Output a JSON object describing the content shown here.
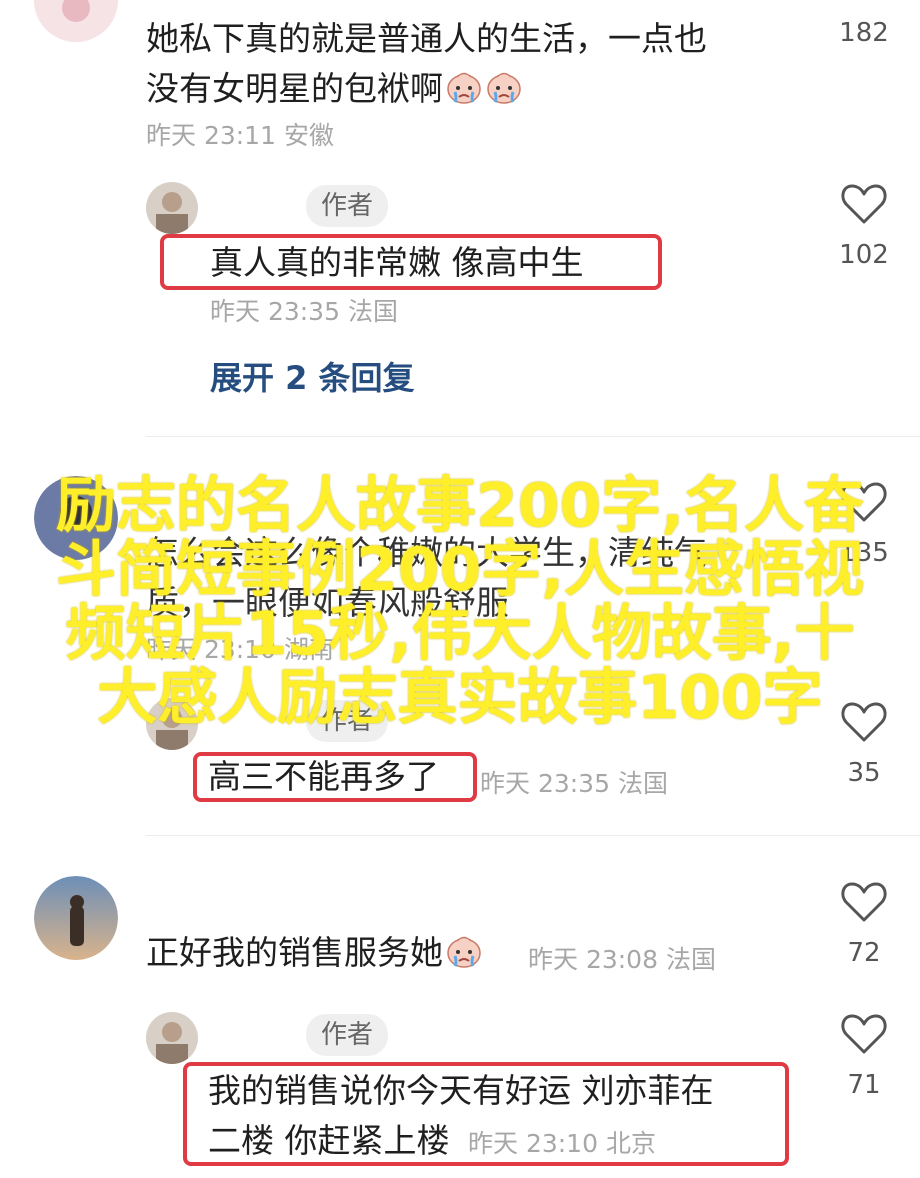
{
  "comments": [
    {
      "text_line1": "她私下真的就是普通人的生活，一点也",
      "text_line2": "没有女明星的包袱啊",
      "meta": "昨天 23:11 安徽",
      "likes": "182"
    },
    {
      "badge": "作者",
      "text": "真人真的非常嫩 像高中生",
      "meta": "昨天 23:35 法国",
      "likes": "102"
    },
    {
      "likes": "135",
      "text_line1": "怎么会这么像个稚嫩的大学生，清纯气",
      "text_line2": "质，一眼便如春风般舒服",
      "meta": "昨天 23:10 湖南"
    },
    {
      "badge": "作者",
      "text": "高三不能再多了",
      "meta": "昨天 23:35 法国",
      "likes": "35"
    },
    {
      "text": "正好我的销售服务她",
      "meta": "昨天 23:08 法国",
      "likes": "72"
    },
    {
      "badge": "作者",
      "text_line1": "我的销售说你今天有好运 刘亦菲在",
      "text_line2": "二楼 你赶紧上楼",
      "meta": "昨天 23:10 北京",
      "likes": "71"
    }
  ],
  "expand_replies": "展开 2 条回复",
  "overlay_lines": [
    "励志的名人故事200字,名人奋",
    "斗简短事例200字,人生感悟视",
    "频短片15秒,伟大人物故事,十",
    "大感人励志真实故事100字"
  ],
  "colors": {
    "highlight": "#e03a44",
    "expand_link": "#264d80",
    "overlay_text": "#ffef2a"
  },
  "icons": [
    "heart-outline-icon",
    "crying-emoji-icon"
  ]
}
